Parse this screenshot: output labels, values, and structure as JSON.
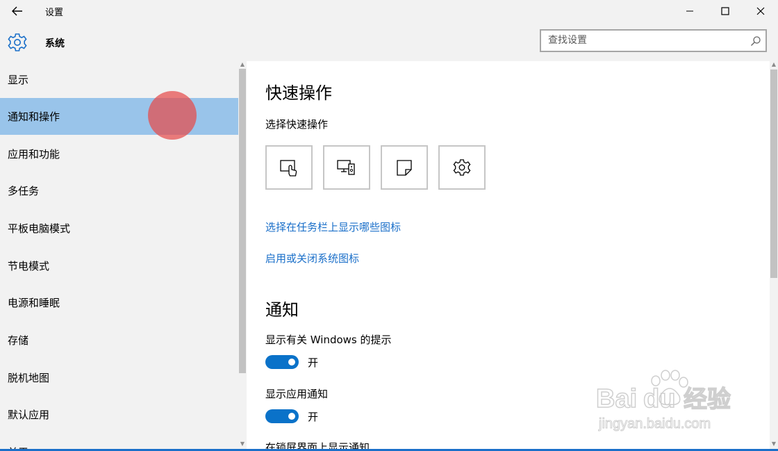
{
  "window": {
    "title": "设置",
    "back_icon": "back-arrow-icon",
    "minimize_icon": "minimize-icon",
    "maximize_icon": "maximize-icon",
    "close_icon": "close-icon"
  },
  "header": {
    "section_icon": "gear-icon",
    "section_title": "系统",
    "search_placeholder": "查找设置",
    "search_icon": "search-icon"
  },
  "sidebar": {
    "items": [
      {
        "label": "显示",
        "active": false
      },
      {
        "label": "通知和操作",
        "active": true
      },
      {
        "label": "应用和功能",
        "active": false
      },
      {
        "label": "多任务",
        "active": false
      },
      {
        "label": "平板电脑模式",
        "active": false
      },
      {
        "label": "节电模式",
        "active": false
      },
      {
        "label": "电源和睡眠",
        "active": false
      },
      {
        "label": "存储",
        "active": false
      },
      {
        "label": "脱机地图",
        "active": false
      },
      {
        "label": "默认应用",
        "active": false
      },
      {
        "label": "关于",
        "active": false
      }
    ]
  },
  "main": {
    "quick_actions": {
      "heading": "快速操作",
      "subheading": "选择快速操作",
      "tiles": [
        {
          "icon": "tablet-mode-icon"
        },
        {
          "icon": "connect-icon"
        },
        {
          "icon": "note-icon"
        },
        {
          "icon": "all-settings-icon"
        }
      ]
    },
    "links": [
      "选择在任务栏上显示哪些图标",
      "启用或关闭系统图标"
    ],
    "notifications": {
      "heading": "通知",
      "settings": [
        {
          "label": "显示有关 Windows 的提示",
          "state": "开",
          "on": true
        },
        {
          "label": "显示应用通知",
          "state": "开",
          "on": true
        }
      ],
      "next_label": "在锁屏界面上显示通知"
    }
  },
  "watermark": {
    "brand": "Baidu经验",
    "url": "jingyan.baidu.com"
  },
  "colors": {
    "accent": "#0a72c9",
    "link": "#1a6fc9",
    "selected_nav": "#99c4ea",
    "chrome_bg": "#f2f2f2",
    "click_indicator": "#e44b4b"
  }
}
